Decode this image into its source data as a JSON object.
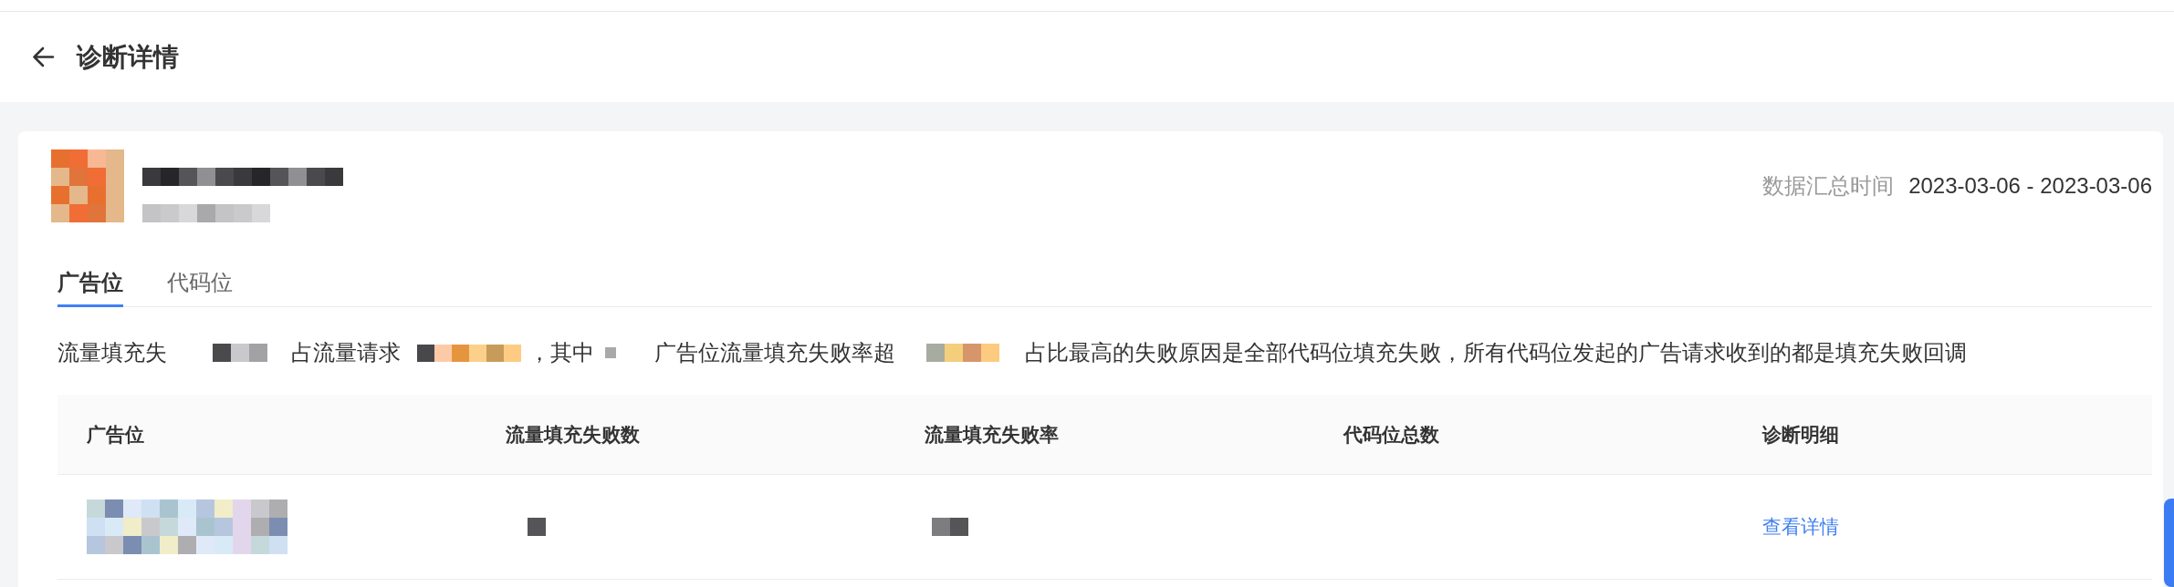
{
  "header": {
    "title": "诊断详情"
  },
  "date_range": {
    "label": "数据汇总时间",
    "value": "2023-03-06 - 2023-03-06"
  },
  "tabs": [
    {
      "label": "广告位",
      "selected": true
    },
    {
      "label": "代码位",
      "selected": false
    }
  ],
  "summary": [
    {
      "kind": "text",
      "text": "流量填充失"
    },
    {
      "kind": "redacted"
    },
    {
      "kind": "text",
      "text": "占流量请求"
    },
    {
      "kind": "redacted"
    },
    {
      "kind": "text",
      "text": "，其中"
    },
    {
      "kind": "redacted"
    },
    {
      "kind": "text",
      "text": "广告位流量填充失败率超"
    },
    {
      "kind": "redacted"
    },
    {
      "kind": "text",
      "text": "占比最高的失败原因是全部代码位填充失败，所有代码位发起的广告请求收到的都是填充失败回调"
    }
  ],
  "table": {
    "columns": [
      "广告位",
      "流量填充失败数",
      "流量填充失败率",
      "代码位总数",
      "诊断明细"
    ],
    "rows": [
      {
        "cells": [
          {
            "kind": "redacted"
          },
          {
            "kind": "redacted"
          },
          {
            "kind": "redacted"
          },
          {
            "kind": "blank"
          },
          {
            "kind": "link",
            "text": "查看详情"
          }
        ]
      }
    ]
  }
}
